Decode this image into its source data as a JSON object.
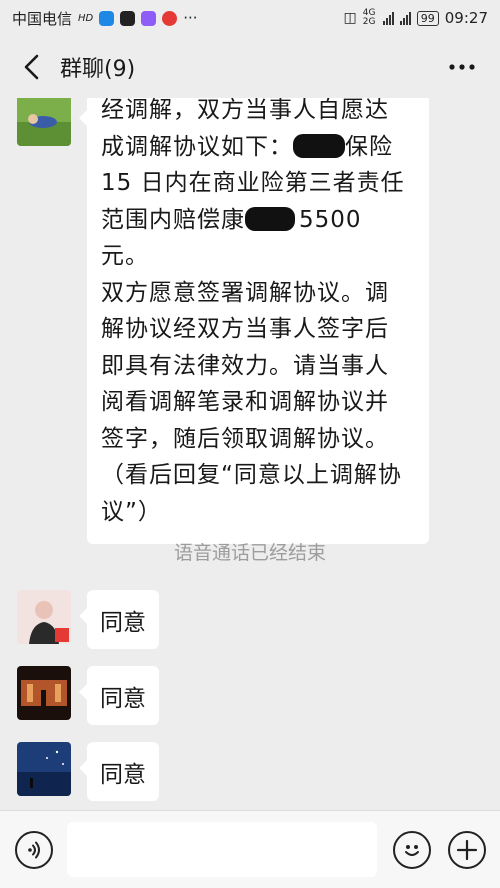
{
  "status_bar": {
    "carrier": "中国电信",
    "more_indicator": "···",
    "network": "4G",
    "network2": "2G",
    "battery": "99",
    "time": "09:27"
  },
  "header": {
    "title": "群聊(9)",
    "back_icon": "chevron-left-icon",
    "more_icon": "more-dots-icon"
  },
  "messages": [
    {
      "type": "text",
      "lines": [
        "经调解，双方当事人自愿达",
        "成调解协议如下：",
        "保险",
        "15 日内在商业险第三者责任",
        "范围内赔偿康",
        "5500 元。",
        "双方愿意签署调解协议。调",
        "解协议经双方当事人签字后",
        "即具有法律效力。请当事人",
        "阅看调解笔录和调解协议并",
        "签字，随后领取调解协议。",
        "（看后回复“同意以上调解协",
        "议”）"
      ]
    },
    {
      "type": "text",
      "text": "同意"
    },
    {
      "type": "text",
      "text": "同意"
    },
    {
      "type": "text",
      "text": "同意"
    }
  ],
  "system_notice": "语音通话已经结束",
  "input_bar": {
    "voice_icon": "voice-icon",
    "emoji_icon": "emoji-icon",
    "plus_icon": "plus-icon",
    "value": ""
  }
}
